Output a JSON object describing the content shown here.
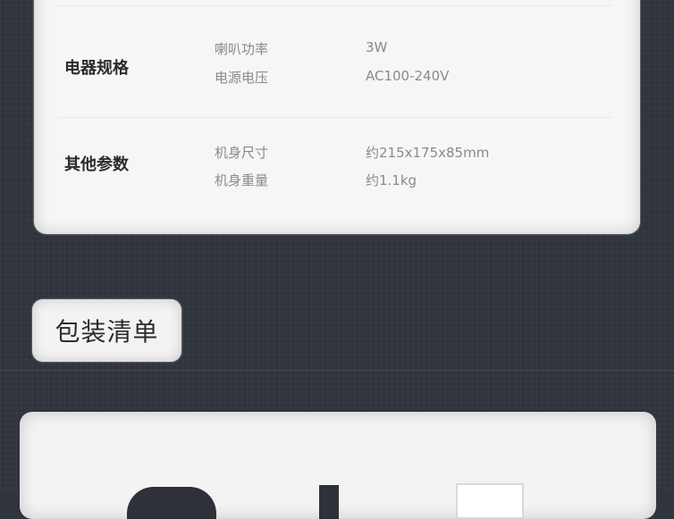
{
  "specs": {
    "rows": [
      {
        "title": "电器规格",
        "items": [
          {
            "label": "喇叭功率",
            "value": "3W"
          },
          {
            "label": "电源电压",
            "value": "AC100-240V"
          }
        ]
      },
      {
        "title": "其他参数",
        "items": [
          {
            "label": "机身尺寸",
            "value": "约215x175x85mm"
          },
          {
            "label": "机身重量",
            "value": "约1.1kg"
          }
        ]
      }
    ]
  },
  "packing": {
    "tab_label": "包装清单"
  },
  "colors": {
    "background": "#30343c",
    "card": "#f6f6f7",
    "title_text": "#2b2b2b",
    "muted_text": "#8a8a8a"
  }
}
